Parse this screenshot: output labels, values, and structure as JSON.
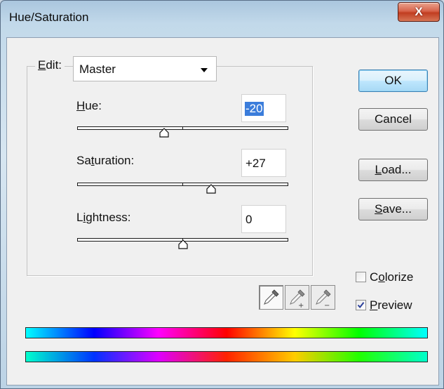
{
  "window": {
    "title": "Hue/Saturation",
    "close_glyph": "X"
  },
  "edit": {
    "label_prefix": "E",
    "label_rest": "dit:",
    "value": "Master"
  },
  "sliders": {
    "hue": {
      "label_prefix": "H",
      "label_rest": "ue:",
      "value": "-20",
      "position_fraction": 0.411
    },
    "saturation": {
      "label_prefix": "Sa",
      "label_key": "t",
      "label_rest": "uration:",
      "value": "+27",
      "position_fraction": 0.635
    },
    "lightness": {
      "label_prefix": "L",
      "label_key": "i",
      "label_rest": "ghtness:",
      "value": "0",
      "position_fraction": 0.5
    }
  },
  "buttons": {
    "ok": "OK",
    "cancel": "Cancel",
    "load_key": "L",
    "load_rest": "oad...",
    "save_key": "S",
    "save_rest": "ave..."
  },
  "checkboxes": {
    "colorize": {
      "prefix": "C",
      "key": "o",
      "rest": "lorize",
      "checked": false
    },
    "preview": {
      "prefix": "",
      "key": "P",
      "rest": "review",
      "checked": true
    }
  },
  "eyedroppers": [
    "eyedropper-icon",
    "eyedropper-plus-icon",
    "eyedropper-minus-icon"
  ],
  "colors": {
    "title_close": "#c13d21",
    "default_button_border": "#3c7fb1",
    "selection": "#3b7ddb"
  }
}
